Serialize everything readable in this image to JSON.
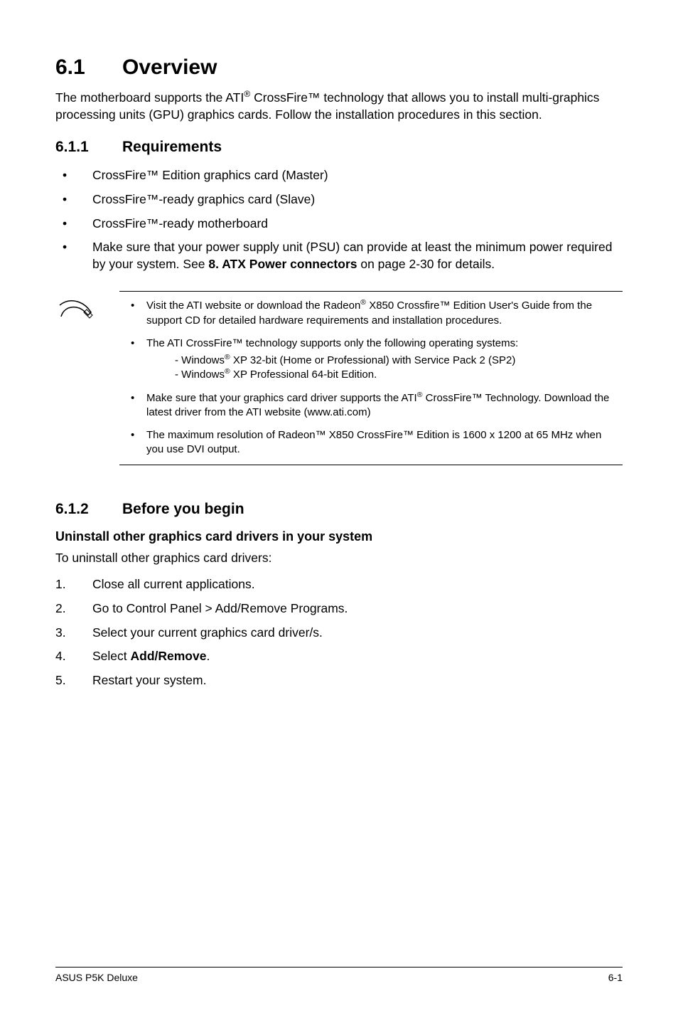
{
  "section": {
    "number": "6.1",
    "title": "Overview"
  },
  "intro": "The motherboard supports the ATI® CrossFire™ technology that allows you to install multi-graphics processing units (GPU) graphics cards. Follow the installation procedures in this section.",
  "sub1": {
    "number": "6.1.1",
    "title": "Requirements",
    "bullets": [
      "CrossFire™ Edition graphics card (Master)",
      "CrossFire™-ready graphics card (Slave)",
      "CrossFire™-ready motherboard",
      "Make sure that your power supply unit (PSU) can provide at least the minimum power required by your system. See 8. ATX Power connectors on page 2-30 for details."
    ]
  },
  "note": {
    "items": [
      {
        "text": "Visit the ATI website or download the Radeon® X850 Crossfire™ Edition User's Guide from the support CD for detailed hardware requirements and installation procedures."
      },
      {
        "text": "The ATI CrossFire™ technology supports only the following operating systems:",
        "sub": [
          "- Windows® XP 32-bit  (Home or Professional) with Service Pack 2 (SP2)",
          "- Windows® XP Professional 64-bit Edition."
        ]
      },
      {
        "text": "Make sure that your graphics card driver supports the ATI® CrossFire™ Technology. Download the latest driver from the ATI website (www.ati.com)"
      },
      {
        "text": "The maximum resolution of Radeon™ X850 CrossFire™ Edition is 1600 x 1200 at 65 MHz when you use DVI output."
      }
    ]
  },
  "sub2": {
    "number": "6.1.2",
    "title": "Before you begin",
    "heading": "Uninstall other graphics card drivers in your system",
    "intro": "To uninstall other graphics card drivers:",
    "steps": [
      "Close all current applications.",
      "Go to Control Panel > Add/Remove Programs.",
      "Select your current graphics card driver/s.",
      "Select Add/Remove.",
      "Restart your system."
    ]
  },
  "footer": {
    "left": "ASUS P5K Deluxe",
    "right": "6-1"
  }
}
